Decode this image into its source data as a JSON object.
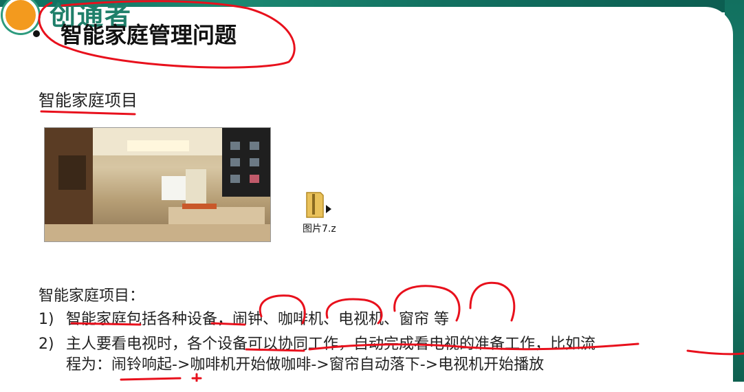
{
  "header": {
    "logo_text": "创通者",
    "title": "智能家庭管理问题"
  },
  "subtitle": "智能家庭项目",
  "attachment": {
    "icon": "zip-folder-icon",
    "label": "图片7.z"
  },
  "section": {
    "heading": "智能家庭项目：",
    "items": [
      {
        "num": "1)",
        "text": "智能家庭包括各种设备，闹钟、咖啡机、电视机、窗帘 等"
      },
      {
        "num": "2)",
        "text": "主人要看电视时，各个设备可以协同工作，自动完成看电视的准备工作，比如流",
        "continuation": "程为：闹铃响起->咖啡机开始做咖啡->窗帘自动落下->电视机开始播放"
      }
    ]
  },
  "colors": {
    "accent": "#1b8a73",
    "annotation": "#e8101c",
    "logo": "#f39a1e"
  }
}
